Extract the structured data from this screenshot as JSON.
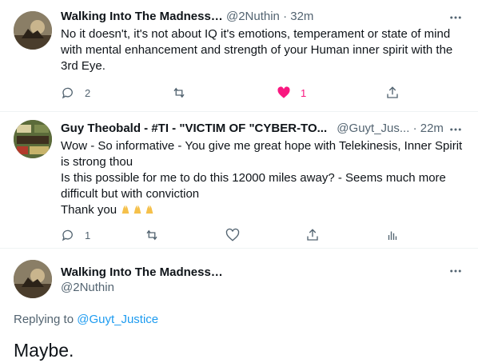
{
  "tweet1": {
    "name": "Walking Into The Madness…",
    "handle": "@2Nuthin",
    "dot": "·",
    "time": "32m",
    "text": "No it doesn't, it's not about IQ it's emotions, temperament or state of mind with mental enhancement and strength of your Human inner spirit with the 3rd Eye.",
    "reply_count": "2",
    "like_count": "1"
  },
  "tweet2": {
    "name": "Guy Theobald - #TI - \"VICTIM OF \"CYBER-TO...",
    "handle": "@Guyt_Jus...",
    "dot": "·",
    "time": "22m",
    "line1": "Wow - So informative - You give me great hope with Telekinesis, Inner Spirit is strong thou",
    "line2": "Is this possible for me to do this 12000 miles away? - Seems much more difficult but with conviction",
    "line3": "Thank you",
    "reply_count": "1"
  },
  "main": {
    "name": "Walking Into The Madness…",
    "handle": "@2Nuthin",
    "replying_prefix": "Replying to",
    "replying_handle": "@Guyt_Justice",
    "text": "Maybe."
  },
  "colors": {
    "text": "#0f1419",
    "secondary": "#536471",
    "link": "#1d9bf0",
    "like": "#f91880"
  }
}
